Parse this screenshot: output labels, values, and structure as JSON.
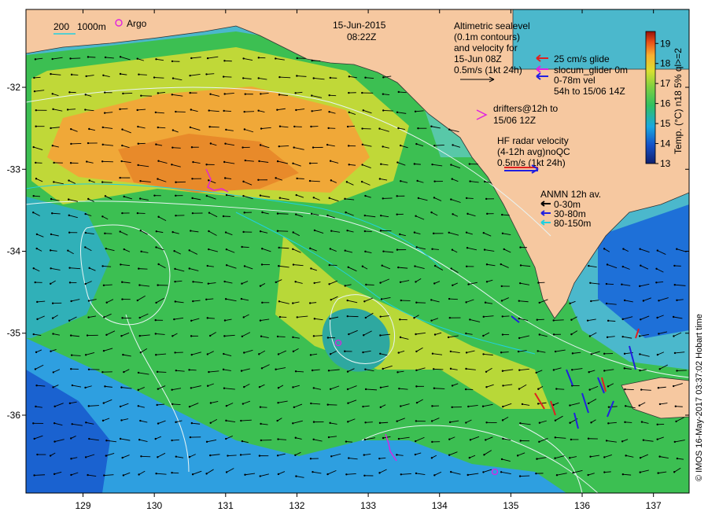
{
  "header": {
    "date": "15-Jun-2015",
    "time": "08:22Z"
  },
  "top_left": {
    "scale_200": "200",
    "scale_1000": "1000m",
    "argo": "Argo"
  },
  "notes": {
    "altimetric": [
      "Altimetric sealevel",
      "(0.1m contours)",
      "and velocity for",
      "15-Jun 08Z",
      "0.5m/s (1kt 24h)"
    ],
    "drifters": [
      "drifters@12h to",
      "15/06 12Z"
    ],
    "hf_radar": [
      "HF radar velocity",
      "(4-12h avg)noQC",
      "0.5m/s (1kt 24h)"
    ]
  },
  "glider_legend": {
    "glide": "25 cm/s glide",
    "slocum": "slocum_glider 0m",
    "vel": "0-78m vel",
    "vel_time": "54h to 15/06 14Z"
  },
  "anmn_legend": {
    "title": "ANMN 12h av.",
    "items": [
      "0-30m",
      "30-80m",
      "80-150m"
    ]
  },
  "colorbar": {
    "label": "Temp. (°C) n18 5% ql>=2",
    "ticks": [
      13,
      14,
      15,
      16,
      17,
      18,
      19
    ],
    "range": [
      13,
      19.6
    ]
  },
  "axes": {
    "x_ticks": [
      129,
      130,
      131,
      132,
      133,
      134,
      135,
      136,
      137
    ],
    "y_ticks": [
      -32,
      -33,
      -34,
      -35,
      -36
    ],
    "lon_range": [
      128.2,
      137.5
    ],
    "lat_range": [
      -36.95,
      -31.05
    ]
  },
  "credit": "© IMOS 16-May-2017 03:37:02 Hobart time",
  "colors": {
    "land": "#f6c8a0",
    "argo": "#e020e0",
    "glide": "#e02020",
    "slocum": "#e020e0",
    "vel": "#2020e0",
    "hf_radar_red": "#e02020",
    "hf_radar_blue": "#2020e0",
    "anmn_0_30": "#000000",
    "anmn_30_80": "#2020e0",
    "anmn_80_150": "#20d0e0",
    "contour": "#e8f4f4"
  }
}
